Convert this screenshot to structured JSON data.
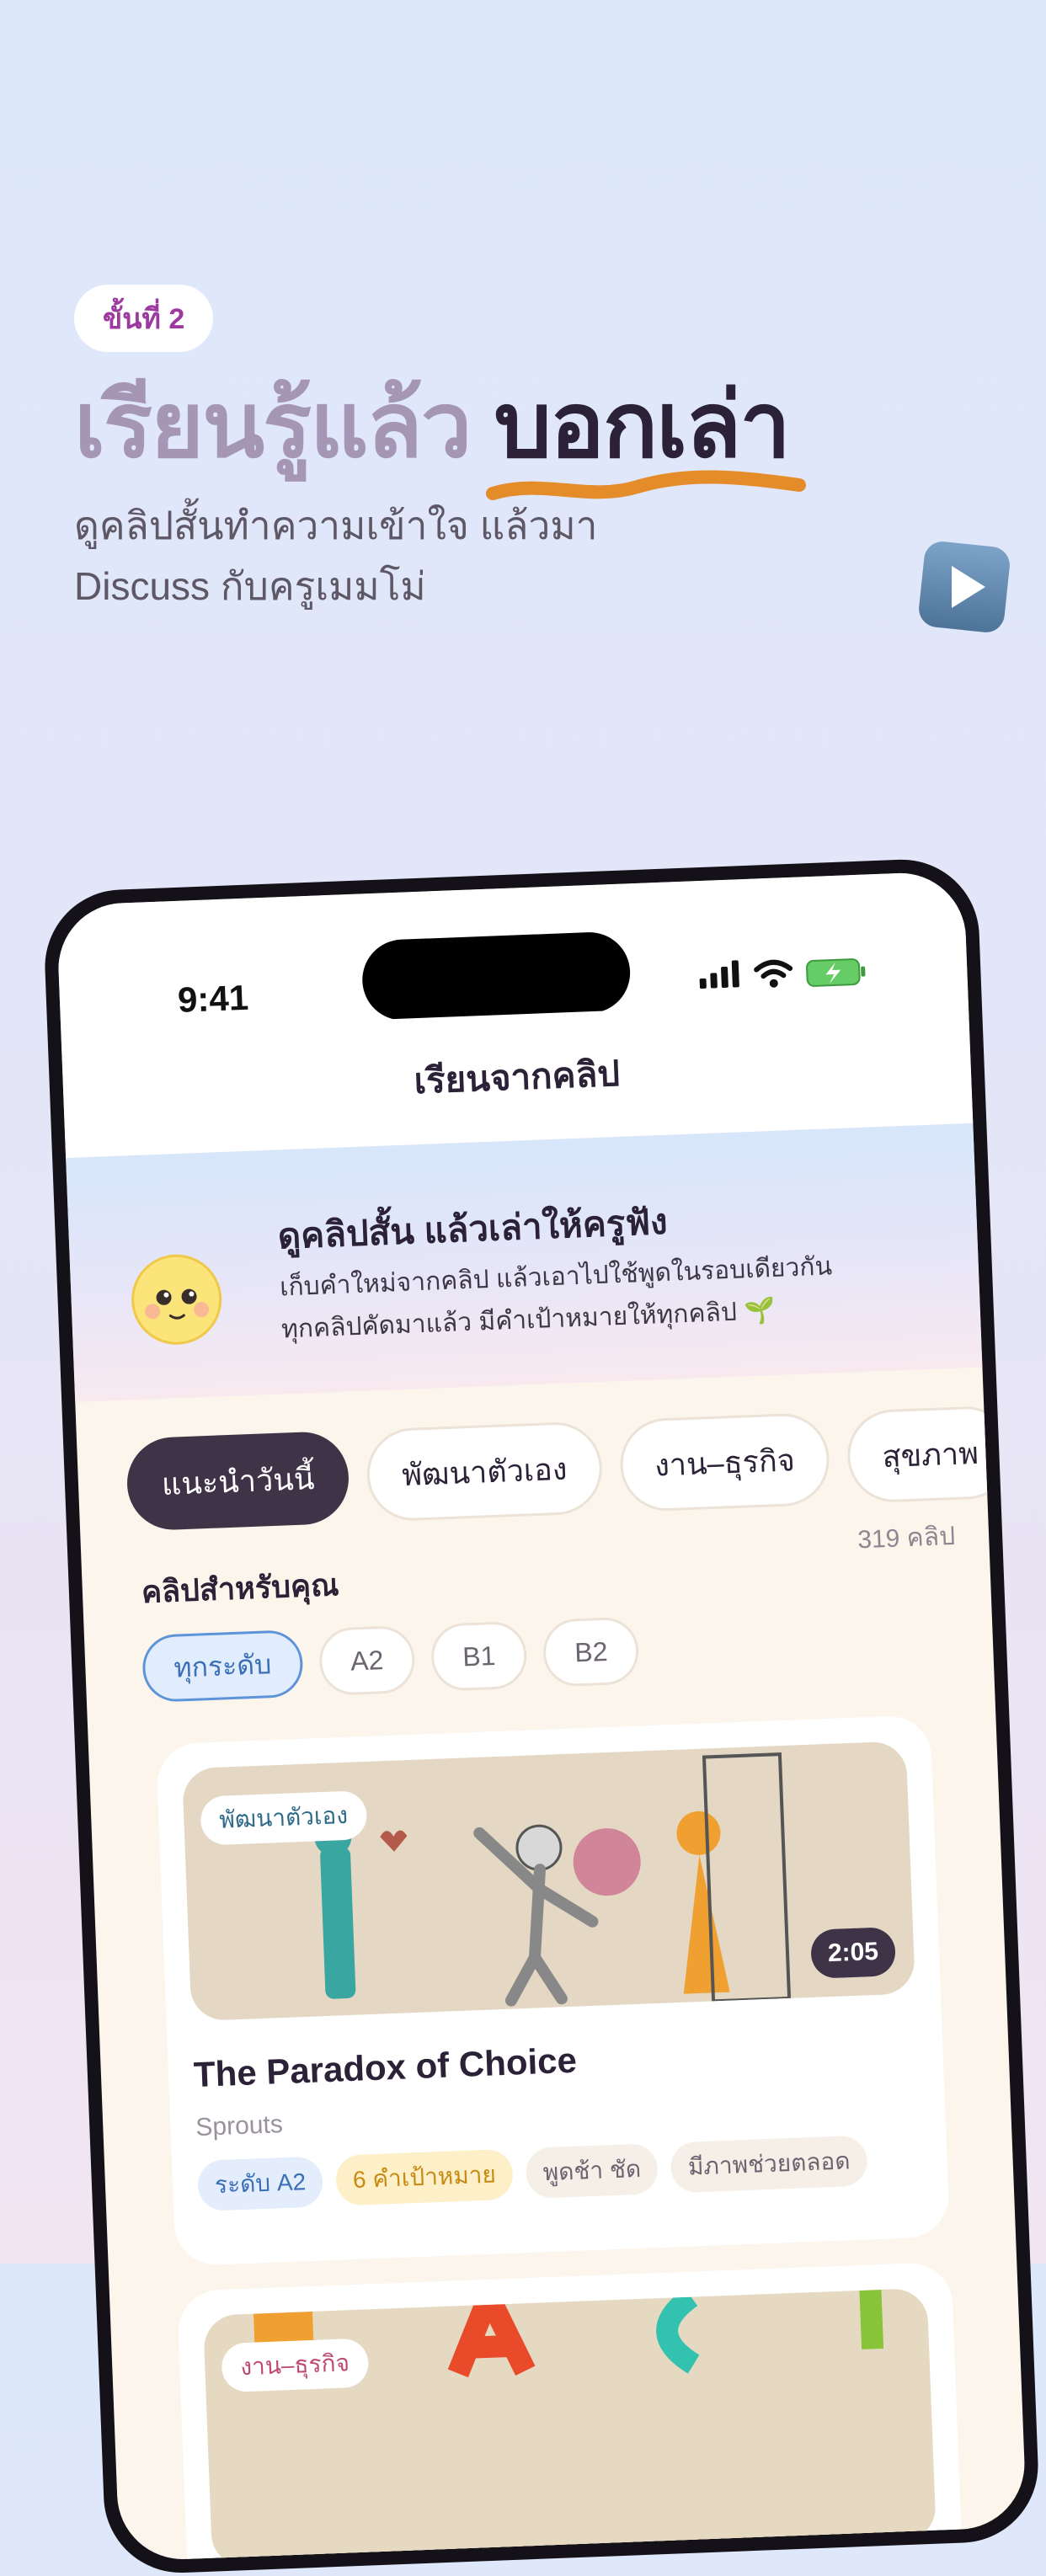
{
  "step": "ขั้นที่ 2",
  "headline": {
    "muted": "เรียนรู้แล้ว",
    "emphasis": "บอกเล่า"
  },
  "subtitle": {
    "line1": "ดูคลิปสั้นทำความเข้าใจ แล้วมา",
    "line2": "Discuss กับครูเมมโม่"
  },
  "phone": {
    "time": "9:41",
    "nav_title": "เรียนจากคลิป",
    "banner": {
      "title": "ดูคลิปสั้น แล้วเล่าให้ครูฟัง",
      "line1": "เก็บคำใหม่จากคลิป แล้วเอาไปใช้พูดในรอบเดียวกัน",
      "line2": "ทุกคลิปคัดมาแล้ว มีคำเป้าหมายให้ทุกคลิป 🌱"
    },
    "categories": [
      "แนะนำวันนี้",
      "พัฒนาตัวเอง",
      "งาน–ธุรกิจ",
      "สุขภาพ"
    ],
    "section_title": "คลิปสำหรับคุณ",
    "clip_count": "319 คลิป",
    "levels": [
      "ทุกระดับ",
      "A2",
      "B1",
      "B2"
    ],
    "card1": {
      "tag": "พัฒนาตัวเอง",
      "duration": "2:05",
      "title": "The Paradox of Choice",
      "source": "Sprouts",
      "chips": [
        "ระดับ A2",
        "6 คำเป้าหมาย",
        "พูดช้า ชัด",
        "มีภาพช่วยตลอด"
      ]
    },
    "card2": {
      "tag": "งาน–ธุรกิจ"
    }
  },
  "colors": {
    "accent": "#e58c2a",
    "dark": "#3f3447",
    "muted_purple": "#a596b6"
  },
  "icons": {
    "play": "play-button-icon",
    "signal": "cellular-signal-icon",
    "wifi": "wifi-icon",
    "battery": "battery-charging-icon",
    "smiley": "smiley-face-icon"
  }
}
